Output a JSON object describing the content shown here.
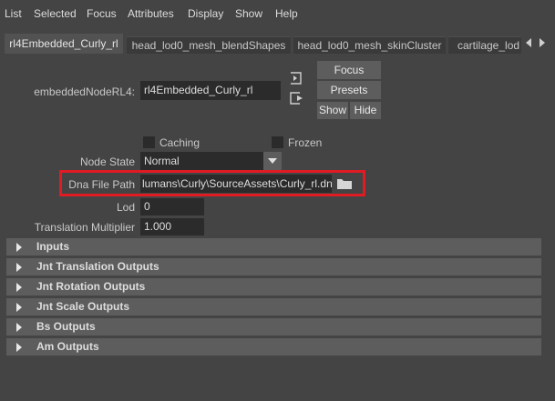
{
  "menu": [
    "List",
    "Selected",
    "Focus",
    "Attributes",
    "Display",
    "Show",
    "Help"
  ],
  "tabs": [
    "rl4Embedded_Curly_rl",
    "head_lod0_mesh_blendShapes",
    "head_lod0_mesh_skinCluster",
    "cartilage_lod"
  ],
  "node": {
    "label": "embeddedNodeRL4:",
    "value": "rl4Embedded_Curly_rl"
  },
  "buttons": {
    "focus": "Focus",
    "presets": "Presets",
    "show": "Show",
    "hide": "Hide"
  },
  "checks": {
    "caching": "Caching",
    "frozen": "Frozen"
  },
  "node_state": {
    "label": "Node State",
    "value": "Normal"
  },
  "dna_file_path": {
    "label": "Dna File Path",
    "value": "lumans\\Curly\\SourceAssets\\Curly_rl.dna"
  },
  "lod": {
    "label": "Lod",
    "value": "0"
  },
  "translation_multiplier": {
    "label": "Translation Multiplier",
    "value": "1.000"
  },
  "sections": [
    "Inputs",
    "Jnt Translation Outputs",
    "Jnt Rotation Outputs",
    "Jnt Scale Outputs",
    "Bs Outputs",
    "Am Outputs"
  ],
  "colors": {
    "background": "#444444",
    "field": "#2b2b2b",
    "button": "#5d5d5d",
    "highlight": "#e01b24"
  }
}
